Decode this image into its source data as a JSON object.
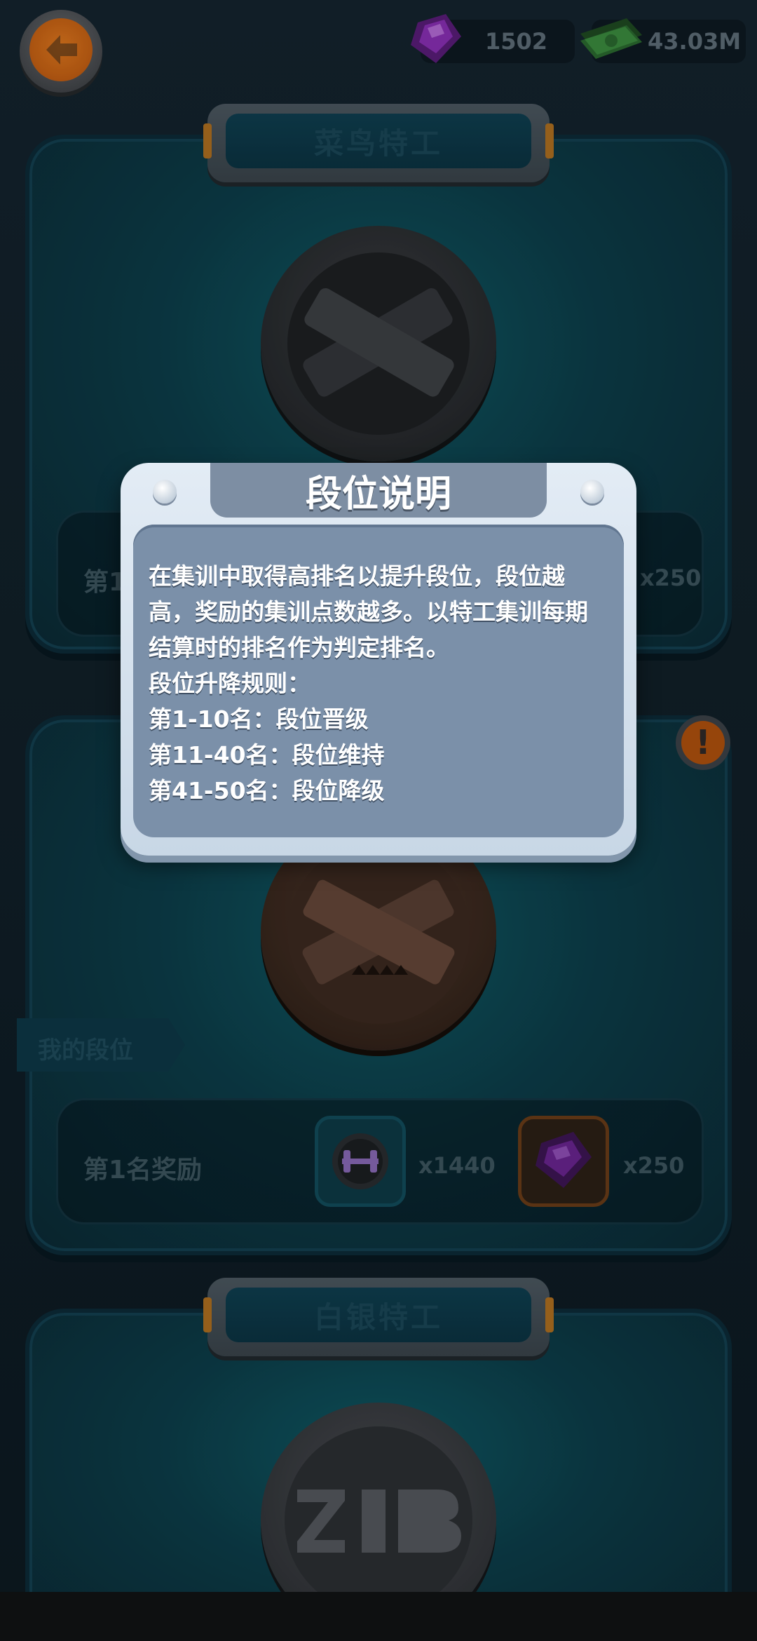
{
  "header": {
    "gems": "1502",
    "cash": "43.03M"
  },
  "tiers": [
    {
      "name": "菜鸟特工",
      "reward_label": "第1名奖励",
      "reward_gems": "x250"
    },
    {
      "name": "",
      "reward_label": "第1名奖励",
      "reward_item_count": "x1440",
      "reward_gems": "x250",
      "my_rank_tag": "我的段位"
    },
    {
      "name": "白银特工"
    }
  ],
  "modal": {
    "title": "段位说明",
    "lines": [
      "在集训中取得高排名以提升段位，段位越",
      "高，奖励的集训点数越多。以特工集训每期",
      "结算时的排名作为判定排名。",
      "段位升降规则：",
      "第1-10名：段位晋级",
      "第11-40名：段位维持",
      "第41-50名：段位降级"
    ]
  },
  "colors": {
    "modal_bg": "#7b90a9",
    "modal_frame": "#e3ecf5",
    "back_button": "#e0781e",
    "card_teal": "#0f5863"
  },
  "icons": [
    "back-arrow-icon",
    "gem-icon",
    "cash-icon",
    "warning-icon",
    "dumbbell-icon"
  ]
}
